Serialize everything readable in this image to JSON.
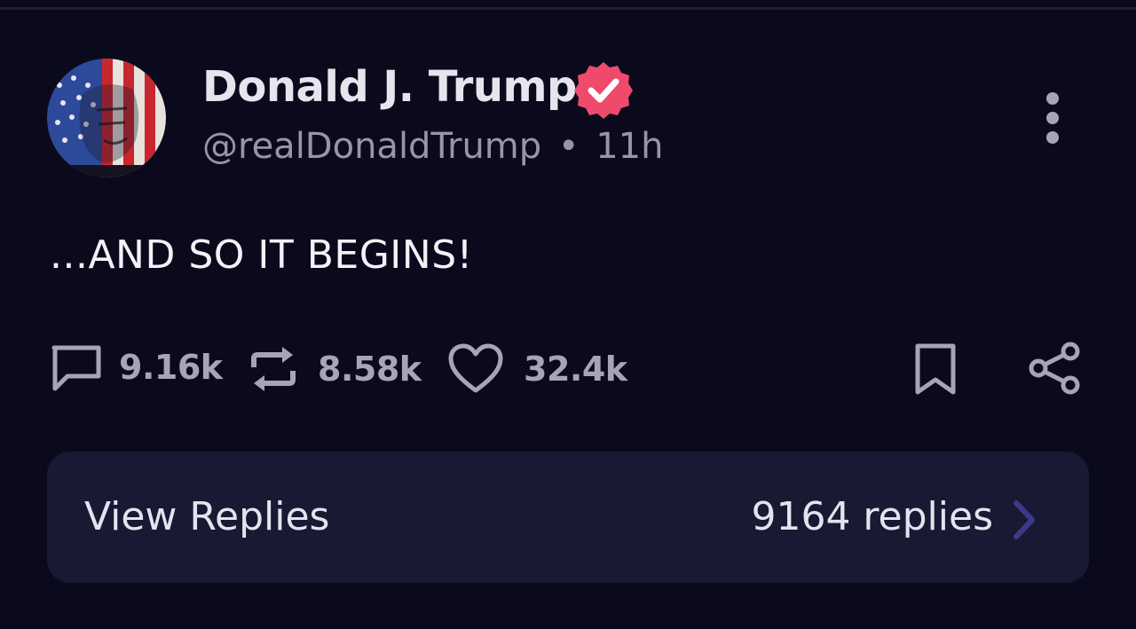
{
  "post": {
    "author": {
      "name": "Donald J. Trump",
      "handle": "@realDonaldTrump",
      "verified": true,
      "avatar": "avatar-image"
    },
    "separator": "•",
    "timestamp": "11h",
    "text": "...AND SO IT BEGINS!",
    "actions": {
      "replies": {
        "icon": "reply-icon",
        "count": "9.16k"
      },
      "reposts": {
        "icon": "repost-icon",
        "count": "8.58k"
      },
      "likes": {
        "icon": "heart-icon",
        "count": "32.4k"
      },
      "bookmark": {
        "icon": "bookmark-icon"
      },
      "share": {
        "icon": "share-icon"
      }
    },
    "menu_icon": "more-vertical-icon"
  },
  "view_replies": {
    "label": "View Replies",
    "count_text": "9164 replies",
    "icon": "chevron-right-icon"
  },
  "colors": {
    "background": "#0b0a1c",
    "card": "#1a1933",
    "verified_badge": "#ef4a6c",
    "muted_text": "#9796a8",
    "chevron": "#3b3a8a"
  }
}
